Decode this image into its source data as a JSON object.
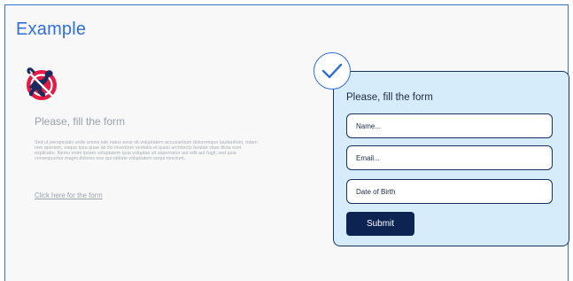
{
  "page": {
    "title": "Example"
  },
  "left": {
    "icon": "no-pets-icon",
    "heading": "Please, fill the form",
    "paragraph": "Sed ut perspiciatis unde omnis iste natus error sit voluptatem accusantium doloremque laudantium, totam rem aperiam, eaque ipsa quae ab illo inventore veritatis et quasi architecto beatae vitae dicta sunt explicabo. Nemo enim ipsam voluptatem quia voluptas sit aspernatur aut odit aut fugit, sed quia consequuntur magni dolores eos qui ratione voluptatem sequi nesciunt.",
    "link_label": "Click here for the form"
  },
  "form": {
    "badge_icon": "checkmark-icon",
    "title": "Please, fill the form",
    "name_placeholder": "Name...",
    "email_placeholder": "Email...",
    "dob_placeholder": "Date of Birth",
    "submit_label": "Submit"
  },
  "colors": {
    "accent": "#2f6fd6",
    "card_background": "#d7ecfb",
    "card_border": "#17325f",
    "submit_background": "#0d2453",
    "icon_red": "#e41b44",
    "icon_navy": "#1b2a5c"
  }
}
